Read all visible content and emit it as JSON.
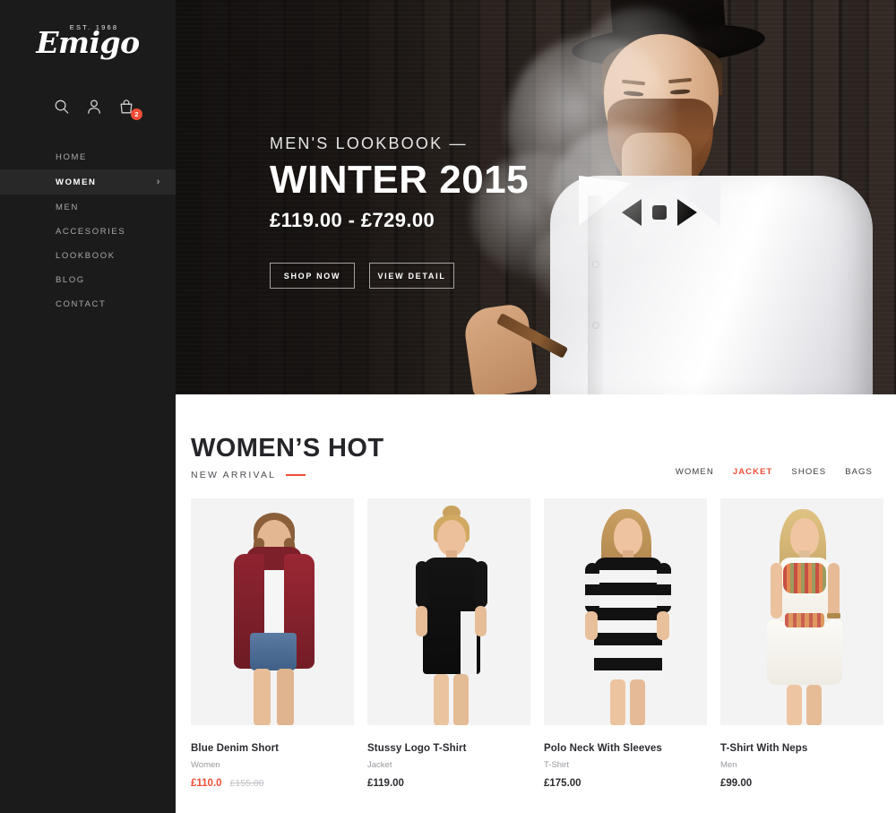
{
  "brand": {
    "est": "EST. 1968",
    "name": "Emigo"
  },
  "toolbar": {
    "search_icon": "search-icon",
    "account_icon": "user-icon",
    "cart_icon": "shopping-bag-icon",
    "cart_count": "2"
  },
  "sidebar": {
    "items": [
      {
        "label": "HOME",
        "active": false,
        "has_chevron": false
      },
      {
        "label": "WOMEN",
        "active": true,
        "has_chevron": true
      },
      {
        "label": "MEN",
        "active": false,
        "has_chevron": false
      },
      {
        "label": "ACCESORIES",
        "active": false,
        "has_chevron": false
      },
      {
        "label": "LOOKBOOK",
        "active": false,
        "has_chevron": false
      },
      {
        "label": "BLOG",
        "active": false,
        "has_chevron": false
      },
      {
        "label": "CONTACT",
        "active": false,
        "has_chevron": false
      }
    ],
    "chevron_glyph": "›"
  },
  "hero": {
    "kicker": "MEN'S LOOKBOOK  —",
    "title": "WINTER 2015",
    "price_range": "£119.00 - £729.00",
    "primary_button": "SHOP NOW",
    "secondary_button": "VIEW DETAIL"
  },
  "section": {
    "title": "WOMEN’S HOT",
    "subtitle": "NEW ARRIVAL",
    "accent_color": "#ef4e37",
    "filters": [
      {
        "label": "WOMEN",
        "active": false
      },
      {
        "label": "JACKET",
        "active": true
      },
      {
        "label": "SHOES",
        "active": false
      },
      {
        "label": "BAGS",
        "active": false
      }
    ]
  },
  "products": [
    {
      "title": "Blue Denim Short",
      "category": "Women",
      "price": "£110.0",
      "old_price": "£155.00",
      "on_sale": true
    },
    {
      "title": "Stussy Logo T-Shirt",
      "category": "Jacket",
      "price": "£119.00",
      "old_price": "",
      "on_sale": false
    },
    {
      "title": "Polo Neck With Sleeves",
      "category": "T-Shirt",
      "price": "£175.00",
      "old_price": "",
      "on_sale": false
    },
    {
      "title": "T-Shirt With Neps",
      "category": "Men",
      "price": "£99.00",
      "old_price": "",
      "on_sale": false
    }
  ]
}
